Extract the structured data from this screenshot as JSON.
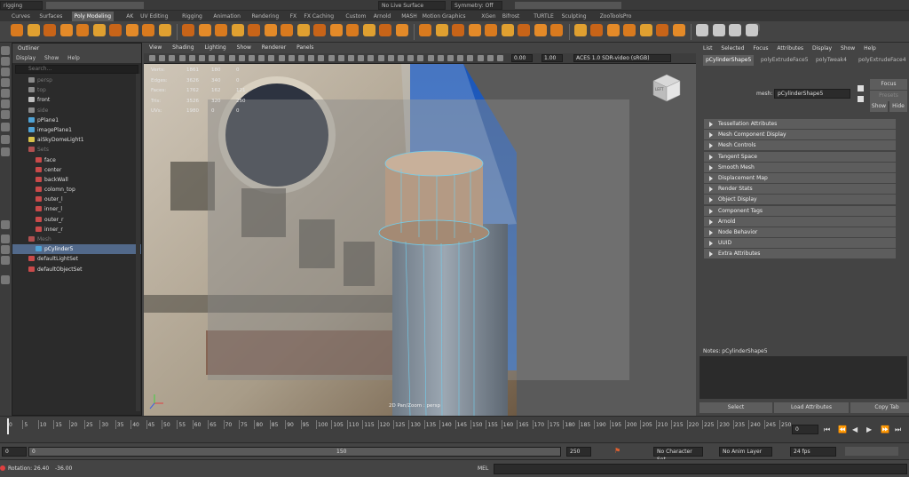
{
  "topbar": {
    "mode": "rigging",
    "live_surface": "No Live Surface",
    "symmetry": "Symmetry: Off"
  },
  "shelf_tabs": [
    "Curves",
    "Surfaces",
    "Poly Modeling",
    "AK",
    "UV Editing",
    "Rigging",
    "Animation",
    "Rendering",
    "FX",
    "FX Caching",
    "Custom",
    "Arnold",
    "MASH",
    "Motion Graphics",
    "XGen",
    "Bifrost",
    "TURTLE",
    "Sculpting",
    "ZooToolsPro"
  ],
  "shelf_active": "Poly Modeling",
  "shelf_set_label": "Set",
  "outliner": {
    "title": "Outliner",
    "menu": [
      "Display",
      "Show",
      "Help"
    ],
    "search_placeholder": "Search...",
    "items": [
      {
        "label": "persp",
        "indent": 0,
        "dim": true,
        "color": "#8a8a8a"
      },
      {
        "label": "top",
        "indent": 0,
        "dim": true,
        "color": "#8a8a8a"
      },
      {
        "label": "front",
        "indent": 0,
        "dim": false,
        "color": "#bfbfbf"
      },
      {
        "label": "side",
        "indent": 0,
        "dim": true,
        "color": "#8a8a8a"
      },
      {
        "label": "pPlane1",
        "indent": 0,
        "dim": false,
        "color": "#4fa3d6"
      },
      {
        "label": "imagePlane1",
        "indent": 0,
        "dim": false,
        "color": "#4fa3d6"
      },
      {
        "label": "aiSkyDomeLight1",
        "indent": 0,
        "dim": false,
        "color": "#d8c24a"
      },
      {
        "label": "Sets",
        "indent": 0,
        "dim": true,
        "color": "#b05050"
      },
      {
        "label": "face",
        "indent": 1,
        "dim": false,
        "color": "#c94a4a"
      },
      {
        "label": "center",
        "indent": 1,
        "dim": false,
        "color": "#c94a4a"
      },
      {
        "label": "backWall",
        "indent": 1,
        "dim": false,
        "color": "#c94a4a"
      },
      {
        "label": "colomn_top",
        "indent": 1,
        "dim": false,
        "color": "#c94a4a"
      },
      {
        "label": "outer_l",
        "indent": 1,
        "dim": false,
        "color": "#c94a4a"
      },
      {
        "label": "inner_l",
        "indent": 1,
        "dim": false,
        "color": "#c94a4a"
      },
      {
        "label": "outer_r",
        "indent": 1,
        "dim": false,
        "color": "#c94a4a"
      },
      {
        "label": "inner_r",
        "indent": 1,
        "dim": false,
        "color": "#c94a4a"
      },
      {
        "label": "Mesh",
        "indent": 0,
        "dim": true,
        "color": "#b05050"
      },
      {
        "label": "pCylinder5",
        "indent": 1,
        "dim": false,
        "selected": true,
        "color": "#4fa3d6"
      },
      {
        "label": "defaultLightSet",
        "indent": 0,
        "dim": false,
        "color": "#c94a4a"
      },
      {
        "label": "defaultObjectSet",
        "indent": 0,
        "dim": false,
        "color": "#c94a4a"
      }
    ]
  },
  "viewport": {
    "menu": [
      "View",
      "Shading",
      "Lighting",
      "Show",
      "Renderer",
      "Panels"
    ],
    "exposure": "0.00",
    "gamma": "1.00",
    "color_space": "ACES 1.0 SDR-video (sRGB)",
    "hud": [
      {
        "label": "Verts:",
        "v1": "1861",
        "v2": "180",
        "v3": "0"
      },
      {
        "label": "Edges:",
        "v1": "3626",
        "v2": "340",
        "v3": "0"
      },
      {
        "label": "Faces:",
        "v1": "1762",
        "v2": "162",
        "v3": "121"
      },
      {
        "label": "Tris:",
        "v1": "3526",
        "v2": "320",
        "v3": "250"
      },
      {
        "label": "UVs:",
        "v1": "1980",
        "v2": "0",
        "v3": "0"
      }
    ],
    "camera_label": "2D Pan/Zoom : persp",
    "viewcube_label": "LEFT"
  },
  "attribute_editor": {
    "menu": [
      "List",
      "Selected",
      "Focus",
      "Attributes",
      "Display",
      "Show",
      "Help"
    ],
    "node_tabs": [
      "pCylinderShape5",
      "polyExtrudeFace5",
      "polyTweak4",
      "polyExtrudeFace4"
    ],
    "mesh_label": "mesh:",
    "mesh_value": "pCylinderShape5",
    "focus_btn": "Focus",
    "presets_btn": "Presets",
    "show_btn": "Show",
    "hide_btn": "Hide",
    "sections": [
      "Tessellation Attributes",
      "Mesh Component Display",
      "Mesh Controls",
      "Tangent Space",
      "Smooth Mesh",
      "Displacement Map",
      "Render Stats",
      "Object Display",
      "Component Tags",
      "Arnold",
      "Node Behavior",
      "UUID",
      "Extra Attributes"
    ],
    "notes_label": "Notes:  pCylinderShape5",
    "select_btn": "Select",
    "load_btn": "Load Attributes",
    "copy_btn": "Copy Tab"
  },
  "timeline": {
    "ticks": [
      "0",
      "5",
      "10",
      "15",
      "20",
      "25",
      "30",
      "35",
      "40",
      "45",
      "50",
      "55",
      "60",
      "65",
      "70",
      "75",
      "80",
      "85",
      "90",
      "95",
      "100",
      "105",
      "110",
      "115",
      "120",
      "125",
      "130",
      "135",
      "140",
      "145",
      "150",
      "155",
      "160",
      "165",
      "170",
      "175",
      "180",
      "185",
      "190",
      "195",
      "200",
      "205",
      "210",
      "215",
      "220",
      "225",
      "230",
      "235",
      "240",
      "245",
      "250"
    ],
    "current_frame": "0"
  },
  "range": {
    "start": "0",
    "inner_start": "0",
    "inner_end": "150",
    "end": "250",
    "character_set": "No Character Set",
    "anim_layer": "No Anim Layer",
    "fps": "24 fps"
  },
  "status": {
    "rotation_label": "Rotation:",
    "rot_x": "26.40",
    "rot_y": "-36.00",
    "mel": "MEL"
  }
}
